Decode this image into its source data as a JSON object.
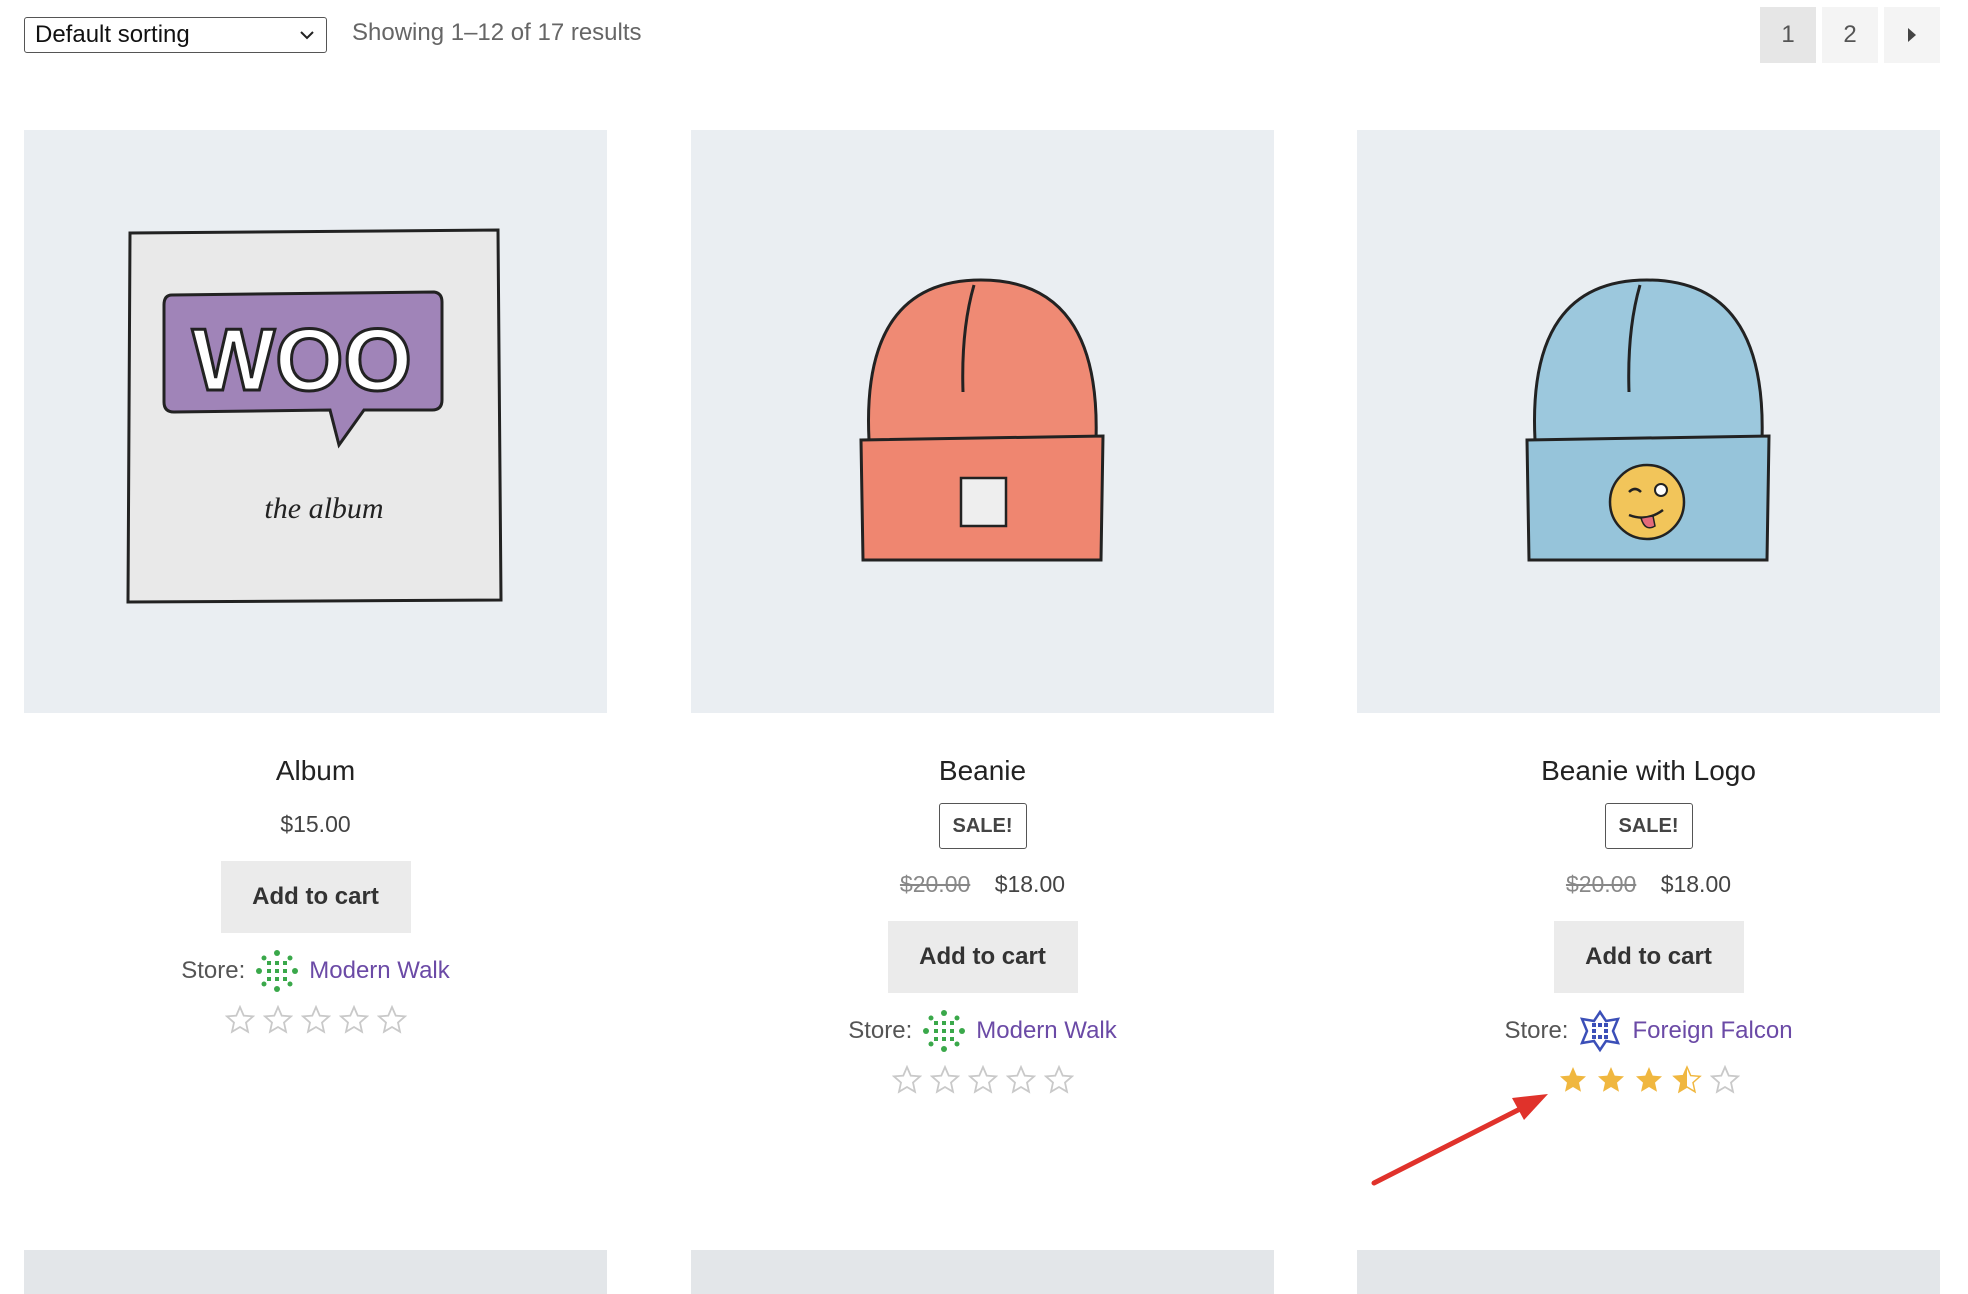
{
  "toolbar": {
    "sort_selected": "Default sorting",
    "result_count": "Showing 1–12 of 17 results"
  },
  "pagination": {
    "pages": [
      "1",
      "2"
    ],
    "current": "1",
    "next_icon": "chevron-right-icon"
  },
  "products": [
    {
      "title": "Album",
      "badge": "",
      "price_old": "",
      "price": "$15.00",
      "cart_label": "Add to cart",
      "store_label": "Store:",
      "store_name": "Modern Walk",
      "rating": 0,
      "rating_max": 5
    },
    {
      "title": "Beanie",
      "badge": "SALE!",
      "price_old": "$20.00",
      "price": "$18.00",
      "cart_label": "Add to cart",
      "store_label": "Store:",
      "store_name": "Modern Walk",
      "rating": 0,
      "rating_max": 5
    },
    {
      "title": "Beanie with Logo",
      "badge": "SALE!",
      "price_old": "$20.00",
      "price": "$18.00",
      "cart_label": "Add to cart",
      "store_label": "Store:",
      "store_name": "Foreign Falcon",
      "rating": 3.5,
      "rating_max": 5
    }
  ],
  "colors": {
    "link": "#6b4aa6",
    "star_filled": "#f0b73f",
    "star_empty": "#c9c9c9",
    "annotation_arrow": "#e0322b",
    "thumb_bg": "#eaeef2"
  },
  "thumb_art": {
    "album_text": "WOO",
    "album_caption": "the album"
  }
}
